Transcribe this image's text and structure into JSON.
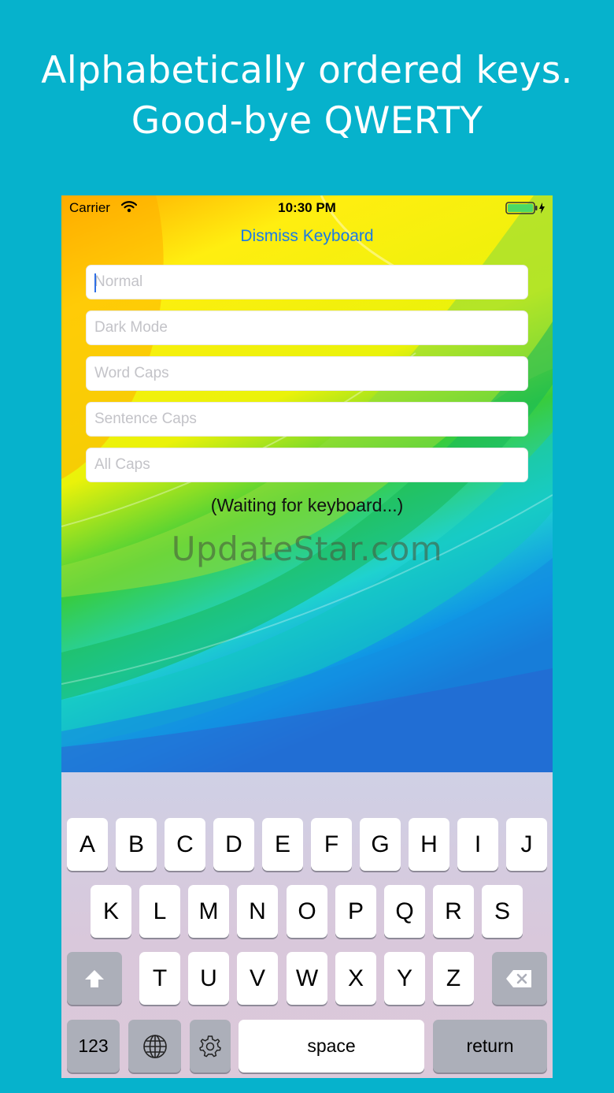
{
  "headline": {
    "line1": "Alphabetically ordered keys.",
    "line2": "Good-bye QWERTY"
  },
  "status_bar": {
    "carrier": "Carrier",
    "time": "10:30 PM",
    "wifi_icon": "wifi-icon",
    "battery_icon": "battery-charging-icon"
  },
  "dismiss_label": "Dismiss Keyboard",
  "fields": [
    {
      "placeholder": "Normal",
      "value": ""
    },
    {
      "placeholder": "Dark Mode",
      "value": ""
    },
    {
      "placeholder": "Word Caps",
      "value": ""
    },
    {
      "placeholder": "Sentence Caps",
      "value": ""
    },
    {
      "placeholder": "All Caps",
      "value": ""
    }
  ],
  "waiting_text": "(Waiting for keyboard...)",
  "watermark": "UpdateStar.com",
  "keyboard": {
    "row1": [
      "A",
      "B",
      "C",
      "D",
      "E",
      "F",
      "G",
      "H",
      "I",
      "J"
    ],
    "row2": [
      "K",
      "L",
      "M",
      "N",
      "O",
      "P",
      "Q",
      "R",
      "S"
    ],
    "row3": [
      "T",
      "U",
      "V",
      "W",
      "X",
      "Y",
      "Z"
    ],
    "numbers_label": "123",
    "space_label": "space",
    "return_label": "return",
    "shift_icon": "shift-arrow-icon",
    "delete_icon": "backspace-icon",
    "globe_icon": "globe-icon",
    "settings_icon": "gear-icon"
  },
  "colors": {
    "background": "#06b2cc",
    "headline": "#ffffff",
    "dismiss": "#1a7ae6",
    "cursor": "#2f6fe5",
    "battery": "#4cd964"
  }
}
